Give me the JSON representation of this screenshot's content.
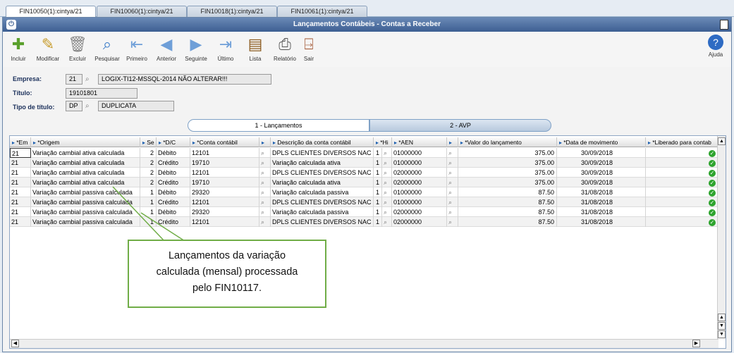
{
  "tabs": [
    {
      "label": "FIN10050(1):cintya/21",
      "active": true
    },
    {
      "label": "FIN10060(1):cintya/21",
      "active": false
    },
    {
      "label": "FIN10018(1):cintya/21",
      "active": false
    },
    {
      "label": "FIN10061(1):cintya/21",
      "active": false
    }
  ],
  "window": {
    "title": "Lançamentos Contábeis - Contas a Receber"
  },
  "toolbar": {
    "incluir": "Incluir",
    "modificar": "Modificar",
    "excluir": "Excluir",
    "pesquisar": "Pesquisar",
    "primeiro": "Primeiro",
    "anterior": "Anterior",
    "seguinte": "Seguinte",
    "ultimo": "Último",
    "lista": "Lista",
    "relatorio": "Relatório",
    "sair": "Sair",
    "ajuda": "Ajuda"
  },
  "form": {
    "empresa_label": "Empresa:",
    "empresa_code": "21",
    "empresa_name": "LOGIX-TI12-MSSQL-2014 NÃO ALTERAR!!!",
    "titulo_label": "Título:",
    "titulo_value": "19101801",
    "tipo_label": "Tipo de título:",
    "tipo_code": "DP",
    "tipo_name": "DUPLICATA"
  },
  "subtabs": {
    "lancamentos": "1 - Lançamentos",
    "avp": "2 - AVP"
  },
  "grid": {
    "headers": {
      "emp": "*Em",
      "origem": "*Origem",
      "seq": "Se",
      "dc": "*D/C",
      "conta": "*Conta contábil",
      "descricao": "Descrição da conta contábil",
      "hist": "*Hi",
      "aen": "*AEN",
      "valor": "*Valor do lançamento",
      "data": "*Data de movimento",
      "liberado": "*Liberado para contab"
    },
    "rows": [
      {
        "emp": "21",
        "origem": "Variação cambial ativa calculada",
        "seq": "2",
        "dc": "Débito",
        "conta": "12101",
        "descricao": "DPLS CLIENTES DIVERSOS NAC",
        "hist": "1",
        "aen": "01000000",
        "valor": "375.00",
        "data": "30/09/2018"
      },
      {
        "emp": "21",
        "origem": "Variação cambial ativa calculada",
        "seq": "2",
        "dc": "Crédito",
        "conta": "19710",
        "descricao": "Variação calculada ativa",
        "hist": "1",
        "aen": "01000000",
        "valor": "375.00",
        "data": "30/09/2018"
      },
      {
        "emp": "21",
        "origem": "Variação cambial ativa calculada",
        "seq": "2",
        "dc": "Débito",
        "conta": "12101",
        "descricao": "DPLS CLIENTES DIVERSOS NAC",
        "hist": "1",
        "aen": "02000000",
        "valor": "375.00",
        "data": "30/09/2018"
      },
      {
        "emp": "21",
        "origem": "Variação cambial ativa calculada",
        "seq": "2",
        "dc": "Crédito",
        "conta": "19710",
        "descricao": "Variação calculada ativa",
        "hist": "1",
        "aen": "02000000",
        "valor": "375.00",
        "data": "30/09/2018"
      },
      {
        "emp": "21",
        "origem": "Variação cambial passiva calculada",
        "seq": "1",
        "dc": "Débito",
        "conta": "29320",
        "descricao": "Variação calculada passiva",
        "hist": "1",
        "aen": "01000000",
        "valor": "87.50",
        "data": "31/08/2018"
      },
      {
        "emp": "21",
        "origem": "Variação cambial passiva calculada",
        "seq": "1",
        "dc": "Crédito",
        "conta": "12101",
        "descricao": "DPLS CLIENTES DIVERSOS NAC",
        "hist": "1",
        "aen": "01000000",
        "valor": "87.50",
        "data": "31/08/2018"
      },
      {
        "emp": "21",
        "origem": "Variação cambial passiva calculada",
        "seq": "1",
        "dc": "Débito",
        "conta": "29320",
        "descricao": "Variação calculada passiva",
        "hist": "1",
        "aen": "02000000",
        "valor": "87.50",
        "data": "31/08/2018"
      },
      {
        "emp": "21",
        "origem": "Variação cambial passiva calculada",
        "seq": "1",
        "dc": "Crédito",
        "conta": "12101",
        "descricao": "DPLS CLIENTES DIVERSOS NAC",
        "hist": "1",
        "aen": "02000000",
        "valor": "87.50",
        "data": "31/08/2018"
      }
    ]
  },
  "callout": {
    "line1": "Lançamentos da variação",
    "line2": "calculada (mensal) processada",
    "line3": "pelo FIN10117."
  },
  "colors": {
    "accent": "#3d5f92",
    "callout_border": "#70ad47",
    "ok": "#2ea42e"
  }
}
